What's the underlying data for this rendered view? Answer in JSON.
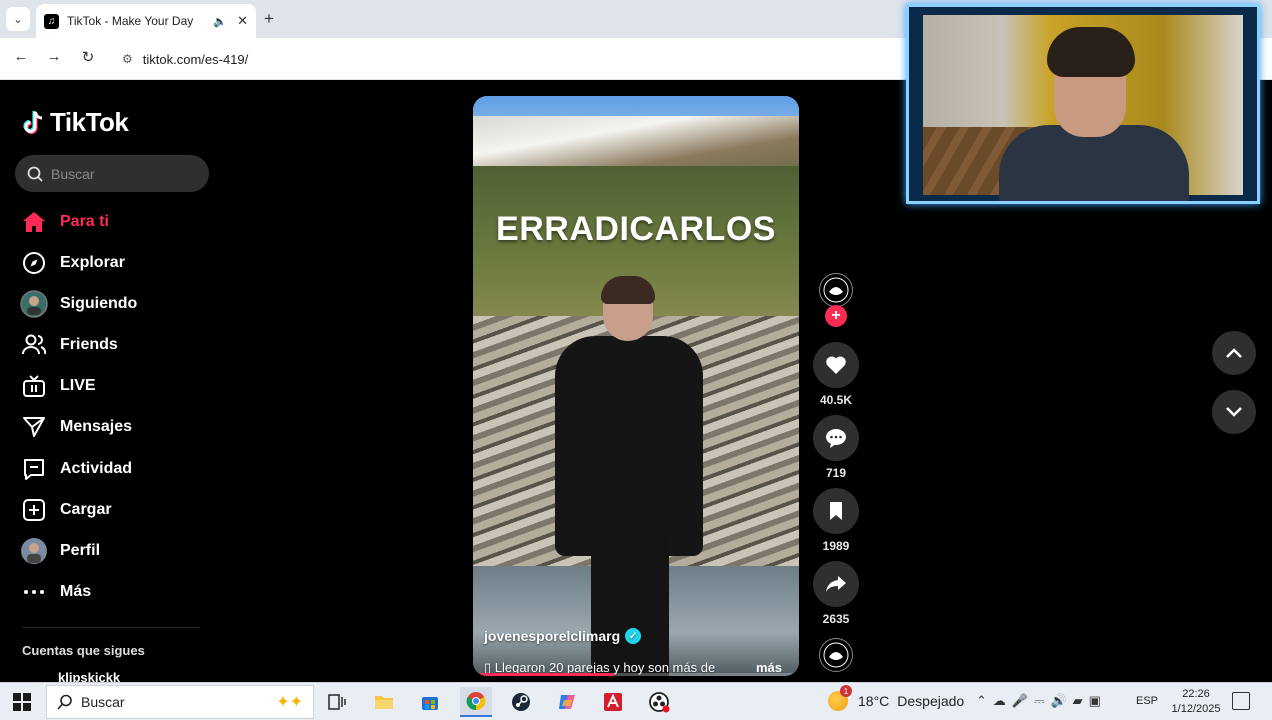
{
  "browser": {
    "tab_title": "TikTok - Make Your Day",
    "url": "tiktok.com/es-419/"
  },
  "tiktok": {
    "logo_text": "TikTok",
    "search_placeholder": "Buscar",
    "nav": [
      {
        "label": "Para ti",
        "icon": "home-icon",
        "active": true
      },
      {
        "label": "Explorar",
        "icon": "compass-icon",
        "active": false
      },
      {
        "label": "Siguiendo",
        "icon": "following-avatar-icon",
        "active": false
      },
      {
        "label": "Friends",
        "icon": "friends-icon",
        "active": false
      },
      {
        "label": "LIVE",
        "icon": "live-tv-icon",
        "active": false
      },
      {
        "label": "Mensajes",
        "icon": "send-icon",
        "active": false
      },
      {
        "label": "Actividad",
        "icon": "activity-icon",
        "active": false
      },
      {
        "label": "Cargar",
        "icon": "upload-plus-icon",
        "active": false
      },
      {
        "label": "Perfil",
        "icon": "profile-avatar-icon",
        "active": false
      },
      {
        "label": "Más",
        "icon": "more-dots-icon",
        "active": false
      }
    ],
    "following_title": "Cuentas que sigues",
    "following_first": "klipskickk",
    "video": {
      "overlay_title": "ERRADICARLOS",
      "author": "jovenesporelclimarg",
      "caption": "▯ Llegaron 20 parejas y hoy son más de",
      "more_label": "más",
      "progress": 0.43
    },
    "actions": {
      "likes": "40.5K",
      "comments": "719",
      "saves": "1989",
      "shares": "2635"
    },
    "colors": {
      "accent": "#fe2c55",
      "verified": "#20d5ec",
      "button_bg": "#2f2f2f"
    }
  },
  "taskbar": {
    "search_placeholder": "Buscar",
    "weather_temp": "18°C",
    "weather_condition": "Despejado",
    "weather_badge": "1",
    "language": "ESP",
    "time": "22:26",
    "date": "1/12/2025",
    "apps": [
      "task-view-icon",
      "file-explorer-icon",
      "store-icon",
      "chrome-icon",
      "steam-icon",
      "copilot-icon",
      "red-app-icon",
      "obs-icon"
    ]
  }
}
